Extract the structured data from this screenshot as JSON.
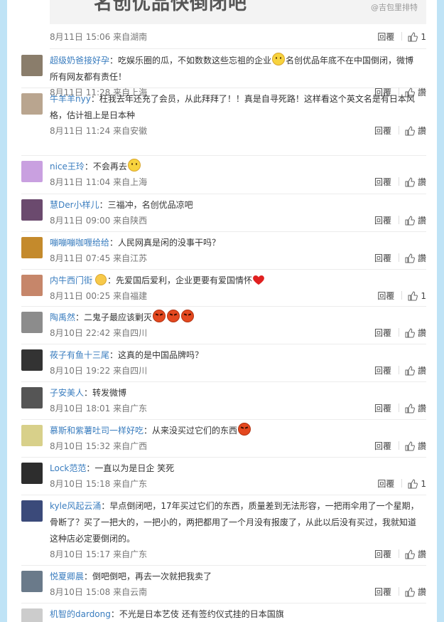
{
  "top_image": {
    "headline": "名创优品快倒闭吧",
    "watermark": "@吉包里排特"
  },
  "top_meta": {
    "time": "8月11日 15:06",
    "from_prefix": "来自",
    "location": "湖南",
    "reply": "回覆",
    "like": "1"
  },
  "comments": [
    {
      "user": "超级奶爸接好孕",
      "text_a": "：吃娱乐圈的瓜，不如数数这些忘祖的企业",
      "emo": [
        "smile"
      ],
      "text_b": "名创优品年底不在中国倒闭，微博所有网友都有责任！",
      "time": "8月11日 11:28",
      "location": "上海",
      "reply": "回覆",
      "like": "讚"
    },
    {
      "user": "牛羊羊nyy",
      "text_a": "：枉我去年还充了会员，从此拜拜了！！真是自寻死路！这样看这个英文名是有日本风格，估计祖上是日本种",
      "emo": [],
      "text_b": "",
      "time": "8月11日 11:24",
      "location": "安徽",
      "reply": "回覆",
      "like": "讚"
    },
    {
      "user": "nice王玲",
      "text_a": "：不会再去",
      "emo": [
        "smile"
      ],
      "text_b": "",
      "time": "8月11日 11:04",
      "location": "上海",
      "reply": "回覆",
      "like": "讚"
    },
    {
      "user": "慧Der小样儿",
      "text_a": "：三福冲，名创优品凉吧",
      "emo": [],
      "text_b": "",
      "time": "8月11日 09:00",
      "location": "陕西",
      "reply": "回覆",
      "like": "讚"
    },
    {
      "user": "嘣嘣嘣咖喱给给",
      "text_a": "：人民网真是闲的没事干吗？",
      "emo": [],
      "text_b": "",
      "time": "8月11日 07:45",
      "location": "江苏",
      "reply": "回覆",
      "like": "讚"
    },
    {
      "user": "内牛西门街",
      "text_a": "：先爱国后爱利，企业更要有爱国情怀",
      "emo": [
        "heart"
      ],
      "text_b": "",
      "time": "8月11日 00:25",
      "location": "福建",
      "reply": "回覆",
      "like": "1",
      "badge": true
    },
    {
      "user": "陶禹然",
      "text_a": "：二鬼子最应该剿灭",
      "emo": [
        "angry",
        "angry",
        "angry"
      ],
      "text_b": "",
      "time": "8月10日 22:42",
      "location": "四川",
      "reply": "回覆",
      "like": "讚"
    },
    {
      "user": "莜子有鱼十三尾",
      "text_a": "：这真的是中国品牌吗？",
      "emo": [],
      "text_b": "",
      "time": "8月10日 19:22",
      "location": "四川",
      "reply": "回覆",
      "like": "讚"
    },
    {
      "user": "子安美人",
      "text_a": "：转发微博",
      "emo": [],
      "text_b": "",
      "time": "8月10日 18:01",
      "location": "广东",
      "reply": "回覆",
      "like": "讚"
    },
    {
      "user": "慕斯和紫薯吐司一样好吃",
      "text_a": "：从来没买过它们的东西",
      "emo": [
        "angry"
      ],
      "text_b": "",
      "time": "8月10日 15:32",
      "location": "广西",
      "reply": "回覆",
      "like": "讚"
    },
    {
      "user": "Lock范范",
      "text_a": "：一直以为是日企 笑死",
      "emo": [],
      "text_b": "",
      "time": "8月10日 15:18",
      "location": "广东",
      "reply": "回覆",
      "like": "1"
    },
    {
      "user": "kyle风起云涌",
      "text_a": "：早点倒闭吧，17年买过它们的东西，质量差到无法形容，一把雨伞用了一个星期，骨断了？买了一把大的，一把小的，两把都用了一个月没有报废了，从此以后没有买过，我就知道这种店必定要倒闭的。",
      "emo": [],
      "text_b": "",
      "time": "8月10日 15:17",
      "location": "广东",
      "reply": "回覆",
      "like": "讚"
    },
    {
      "user": "悦夏卿晨",
      "text_a": "：倒吧倒吧，再去一次就把我卖了",
      "emo": [],
      "text_b": "",
      "time": "8月10日 15:08",
      "location": "云南",
      "reply": "回覆",
      "like": "讚"
    },
    {
      "user": "机智的dardong",
      "text_a": "：不光是日本艺伎 还有签约仪式挂的日本国旗",
      "emo": [],
      "text_b": "",
      "time": "",
      "location": "",
      "reply": "",
      "like": ""
    }
  ]
}
